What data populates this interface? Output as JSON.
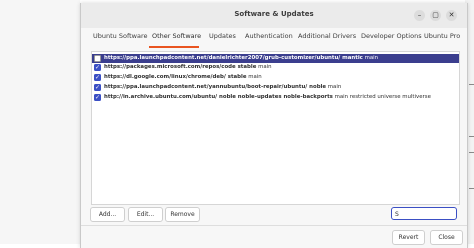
{
  "window": {
    "title": "Software & Updates",
    "controls": {
      "minimize": "–",
      "maximize": "▢",
      "close": "✕"
    }
  },
  "tabs": [
    {
      "label": "Ubuntu Software",
      "active": false
    },
    {
      "label": "Other Software",
      "active": true
    },
    {
      "label": "Updates",
      "active": false
    },
    {
      "label": "Authentication",
      "active": false
    },
    {
      "label": "Additional Drivers",
      "active": false
    },
    {
      "label": "Developer Options",
      "active": false
    },
    {
      "label": "Ubuntu Pro",
      "active": false
    }
  ],
  "sources": [
    {
      "checked": false,
      "selected": true,
      "bold": "https://ppa.launchpadcontent.net/danielrichter2007/grub-customizer/ubuntu/ mantic",
      "rest": " main"
    },
    {
      "checked": true,
      "selected": false,
      "bold": "https://packages.microsoft.com/repos/code stable",
      "rest": " main"
    },
    {
      "checked": true,
      "selected": false,
      "bold": "https://dl.google.com/linux/chrome/deb/ stable",
      "rest": " main"
    },
    {
      "checked": true,
      "selected": false,
      "bold": "https://ppa.launchpadcontent.net/yannubuntu/boot-repair/ubuntu/ noble",
      "rest": " main"
    },
    {
      "checked": true,
      "selected": false,
      "bold": "http://in.archive.ubuntu.com/ubuntu/ noble noble-updates noble-backports",
      "rest": " main restricted universe multiverse"
    }
  ],
  "buttons": {
    "add": "Add...",
    "edit": "Edit...",
    "remove": "Remove",
    "revert": "Revert",
    "close": "Close"
  },
  "search": {
    "value": "S"
  },
  "colors": {
    "accent": "#e95420",
    "selection": "#3b3e8e",
    "checkbox": "#3b4fc4"
  }
}
